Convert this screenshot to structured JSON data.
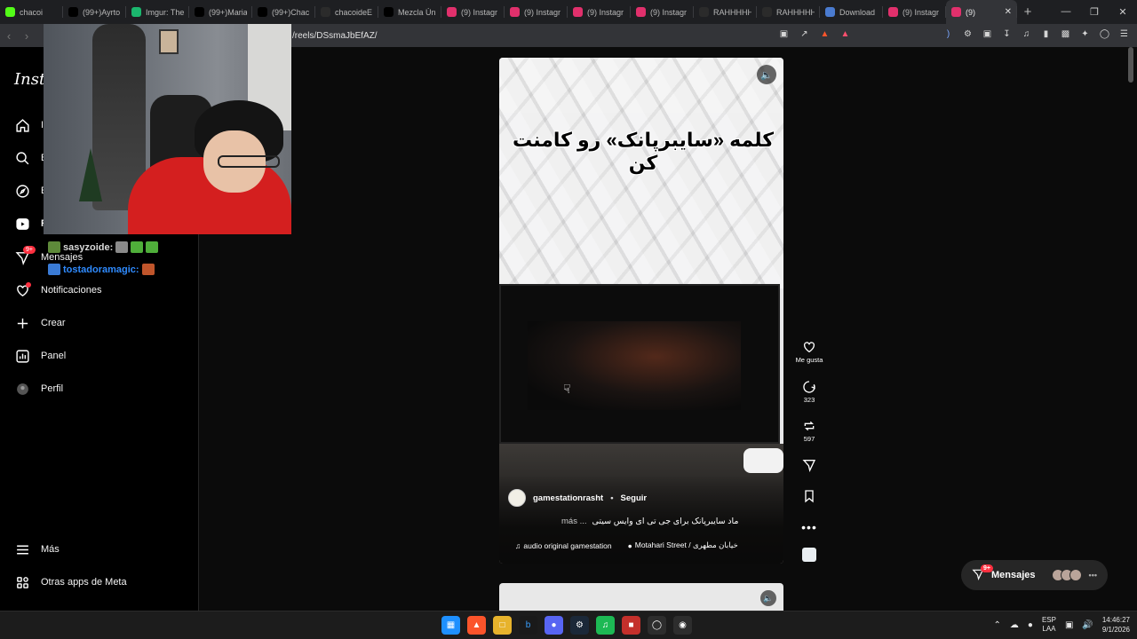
{
  "browser": {
    "tabs": [
      {
        "label": "chacoi",
        "color": "#53fc18",
        "active": false
      },
      {
        "label": "(99+)Ayrto",
        "color": "#000000",
        "active": false
      },
      {
        "label": "Imgur: The",
        "color": "#1bb76e",
        "active": false
      },
      {
        "label": "(99+)Maria",
        "color": "#000000",
        "active": false
      },
      {
        "label": "(99+)Chac",
        "color": "#000000",
        "active": false
      },
      {
        "label": "chacoideE",
        "color": "#2b2b2b",
        "active": false
      },
      {
        "label": "Mezcla Úni",
        "color": "#000000",
        "active": false
      },
      {
        "label": "(9) Instagr",
        "color": "#e1306c",
        "active": false
      },
      {
        "label": "(9) Instagr",
        "color": "#e1306c",
        "active": false
      },
      {
        "label": "(9) Instagr",
        "color": "#e1306c",
        "active": false
      },
      {
        "label": "(9) Instagr",
        "color": "#e1306c",
        "active": false
      },
      {
        "label": "RAHHHHH",
        "color": "#2b2b2b",
        "active": false
      },
      {
        "label": "RAHHHHH",
        "color": "#2b2b2b",
        "active": false
      },
      {
        "label": "Download",
        "color": "#4a7bd0",
        "active": false
      },
      {
        "label": "(9) Instagr",
        "color": "#e1306c",
        "active": false
      },
      {
        "label": "(9)",
        "color": "#e1306c",
        "active": true
      }
    ],
    "url": "/reels/DSsmaJbEfAZ/"
  },
  "sidebar": {
    "logo": "Insta",
    "items": [
      {
        "label": "In",
        "icon": "home-icon"
      },
      {
        "label": "B",
        "icon": "search-icon"
      },
      {
        "label": "E",
        "icon": "explore-icon"
      },
      {
        "label": "R",
        "icon": "reels-icon"
      },
      {
        "label": "Mensajes",
        "icon": "messages-icon",
        "badge": "9+"
      },
      {
        "label": "Notificaciones",
        "icon": "heart-icon"
      },
      {
        "label": "Crear",
        "icon": "plus-icon"
      },
      {
        "label": "Panel",
        "icon": "chart-icon"
      },
      {
        "label": "Perfil",
        "icon": "profile-icon"
      },
      {
        "label": "Más",
        "icon": "menu-icon"
      },
      {
        "label": "Otras apps de Meta",
        "icon": "meta-apps-icon"
      }
    ]
  },
  "chat": {
    "lines": [
      {
        "user": "sasyzoide:",
        "color": "#d9d9d9"
      },
      {
        "user": "tostadoramagic:",
        "color": "#2f8bff"
      }
    ]
  },
  "reel": {
    "headline": "کلمه «سایبرپانک» رو کامنت کن",
    "author": "gamestationrasht",
    "follow": "Seguir",
    "caption_more": "más ...",
    "caption": "ماد سایبرپانک برای جی تی ای وایس سیتی",
    "audio": "audio original  gamestation",
    "location": "Motahari Street / خیابان مطهری",
    "actions": {
      "like_label": "Me gusta",
      "comments": "323",
      "reposts": "597"
    }
  },
  "messages_pill": {
    "label": "Mensajes",
    "badge": "9+"
  },
  "taskbar": {
    "lang_top": "ESP",
    "lang_bottom": "LAA",
    "time": "14:46:27",
    "date": "9/1/2026"
  }
}
